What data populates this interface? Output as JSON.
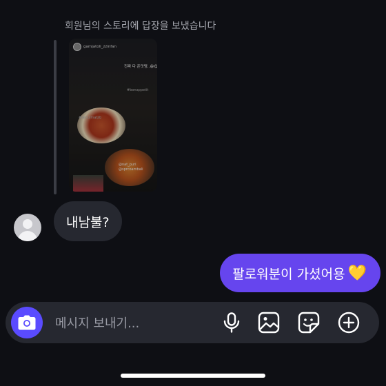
{
  "thread": {
    "reply_note": "회원님의 스토리에 답장을 보냈습니다",
    "story": {
      "username": "gamjatoli_zzinfan",
      "caption_main": "진짜 다 존맛탱..😆😋",
      "caption_tag1": "#bonappetit",
      "caption_tag2": "#seoulmatjib",
      "mention1": "@nat_puri",
      "mention2": "@sprcoambali"
    },
    "incoming_message": "내남불?",
    "outgoing_message": "팔로워분이 가셨어용",
    "outgoing_emoji": "💛"
  },
  "composer": {
    "placeholder": "메시지 보내기..."
  },
  "icons": [
    "camera-icon",
    "microphone-icon",
    "gallery-icon",
    "sticker-icon",
    "add-icon"
  ],
  "colors": {
    "background": "#0e0f14",
    "incoming_bubble": "#262830",
    "outgoing_bubble": "#6645ee",
    "camera_button": "#5a4bff",
    "heart": "#f2c23b"
  }
}
